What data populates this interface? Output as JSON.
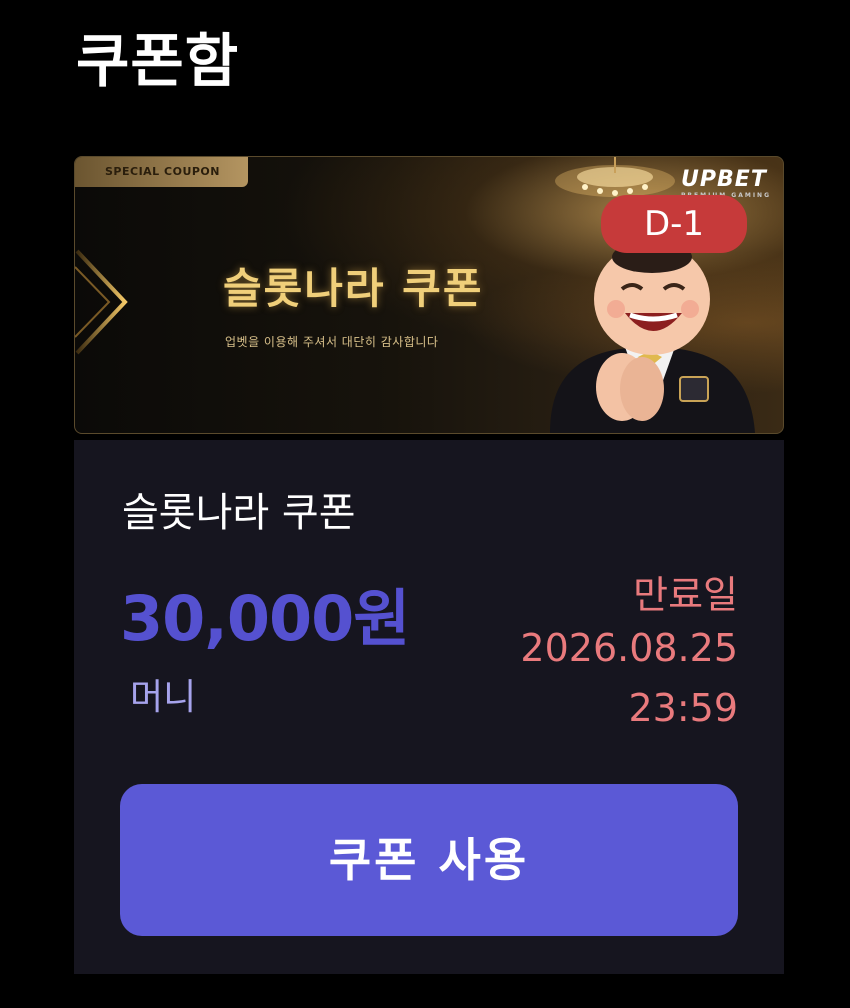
{
  "page": {
    "title": "쿠폰함"
  },
  "banner": {
    "chip_label": "SPECIAL COUPON",
    "title": "슬롯나라 쿠폰",
    "subtitle": "업벳을 이용해 주셔서 대단히 감사합니다",
    "brand": "UPBET",
    "brand_tagline": "PREMIUM GAMING",
    "dday_badge": "D-1",
    "accent_color": "#f0cf7a",
    "badge_color": "#c63a3a"
  },
  "coupon": {
    "name": "슬롯나라 쿠폰",
    "amount": "30,000원",
    "type": "머니",
    "expiry_label": "만료일",
    "expiry_date": "2026.08.25",
    "expiry_time": "23:59",
    "use_button_label": "쿠폰 사용",
    "amount_color": "#5551d0",
    "expiry_color": "#e97a7d",
    "button_color": "#5b59d6"
  },
  "icons": {
    "chevron": "chevron-right-icon",
    "chandelier": "chandelier-icon",
    "mascot": "mascot-illustration"
  }
}
